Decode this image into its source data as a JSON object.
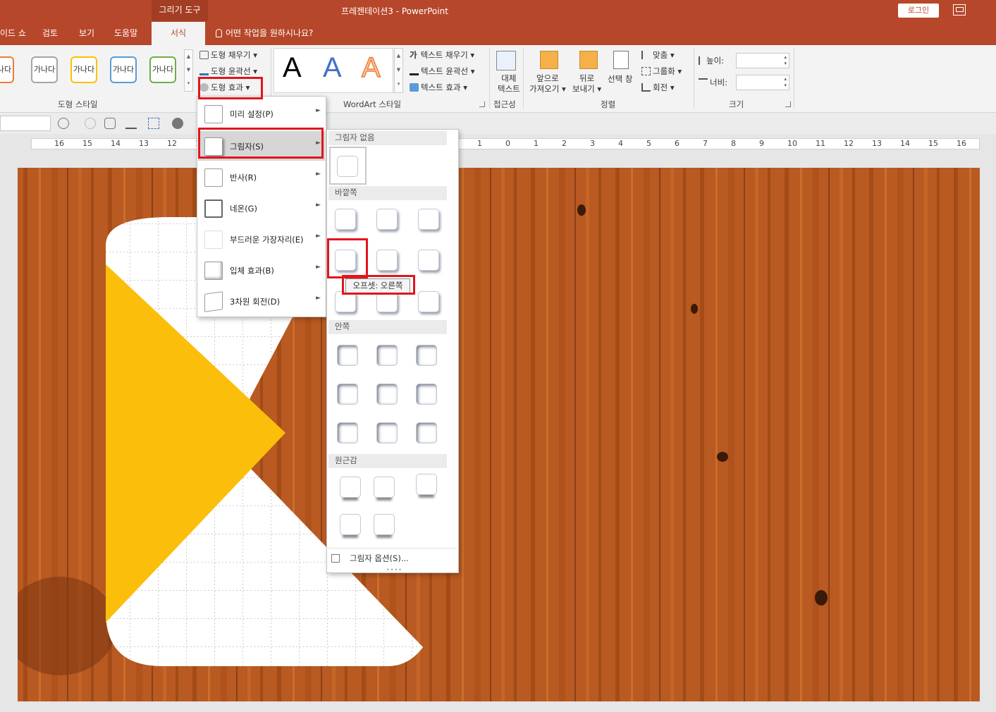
{
  "window": {
    "title": "프레젠테이션3  -  PowerPoint",
    "context_tab": "그리기 도구",
    "login": "로그인"
  },
  "tabs": [
    "이드 쇼",
    "검토",
    "보기",
    "도움말"
  ],
  "active_tab": "서식",
  "tell_me": "어떤 작업을 원하시나요?",
  "ribbon": {
    "shape_styles": {
      "group_label": "도형 스타일",
      "thumbs": [
        "가나다",
        "가나다",
        "가나다",
        "가나다",
        "가나다"
      ],
      "thumb_colors": [
        "#ed7d31",
        "#a5a5a5",
        "#ffc000",
        "#5b9bd5",
        "#70ad47"
      ]
    },
    "shape_fill": "도형 채우기",
    "shape_outline": "도형 윤곽선",
    "shape_effects": "도형 효과",
    "wordart": {
      "group_label": "WordArt 스타일",
      "text_fill": "텍스트 채우기",
      "text_outline": "텍스트 윤곽선",
      "text_effects": "텍스트 효과",
      "sample": "A",
      "sample_colors": [
        "#000000",
        "#4472c4",
        "#ed7d31"
      ]
    },
    "accessibility": {
      "button": [
        "대체",
        "텍스트"
      ],
      "group_label": "접근성"
    },
    "arrange": {
      "bring_forward": [
        "앞으로",
        "가져오기"
      ],
      "send_backward": [
        "뒤로",
        "보내기"
      ],
      "selection_pane": "선택 창",
      "align": "맞춤",
      "group": "그룹화",
      "rotate": "회전",
      "group_label": "정렬"
    },
    "size": {
      "height_label": "높이:",
      "width_label": "너비:",
      "group_label": "크기"
    }
  },
  "effects_menu": {
    "items": [
      {
        "label": "미리 설정(P)"
      },
      {
        "label": "그림자(S)"
      },
      {
        "label": "반사(R)"
      },
      {
        "label": "네온(G)"
      },
      {
        "label": "부드러운 가장자리(E)"
      },
      {
        "label": "입체 효과(B)"
      },
      {
        "label": "3차원 회전(D)"
      }
    ]
  },
  "shadow_gallery": {
    "none_header": "그림자 없음",
    "outer_header": "바깥쪽",
    "inner_header": "안쪽",
    "perspective_header": "원근감",
    "options": "그림자 옵션(S)..."
  },
  "tooltip": "오프셋: 오른쪽",
  "ruler": {
    "labels": [
      "16",
      "15",
      "14",
      "13",
      "12",
      "1",
      "1",
      "0",
      "1",
      "2",
      "3",
      "4",
      "5",
      "6",
      "7",
      "8",
      "9",
      "10",
      "11",
      "12",
      "13",
      "14",
      "15",
      "16"
    ]
  },
  "colors": {
    "accent": "#b7472a",
    "highlight": "#e0161e",
    "arrow": "#fbbe0a",
    "wood": "#b4541c"
  }
}
